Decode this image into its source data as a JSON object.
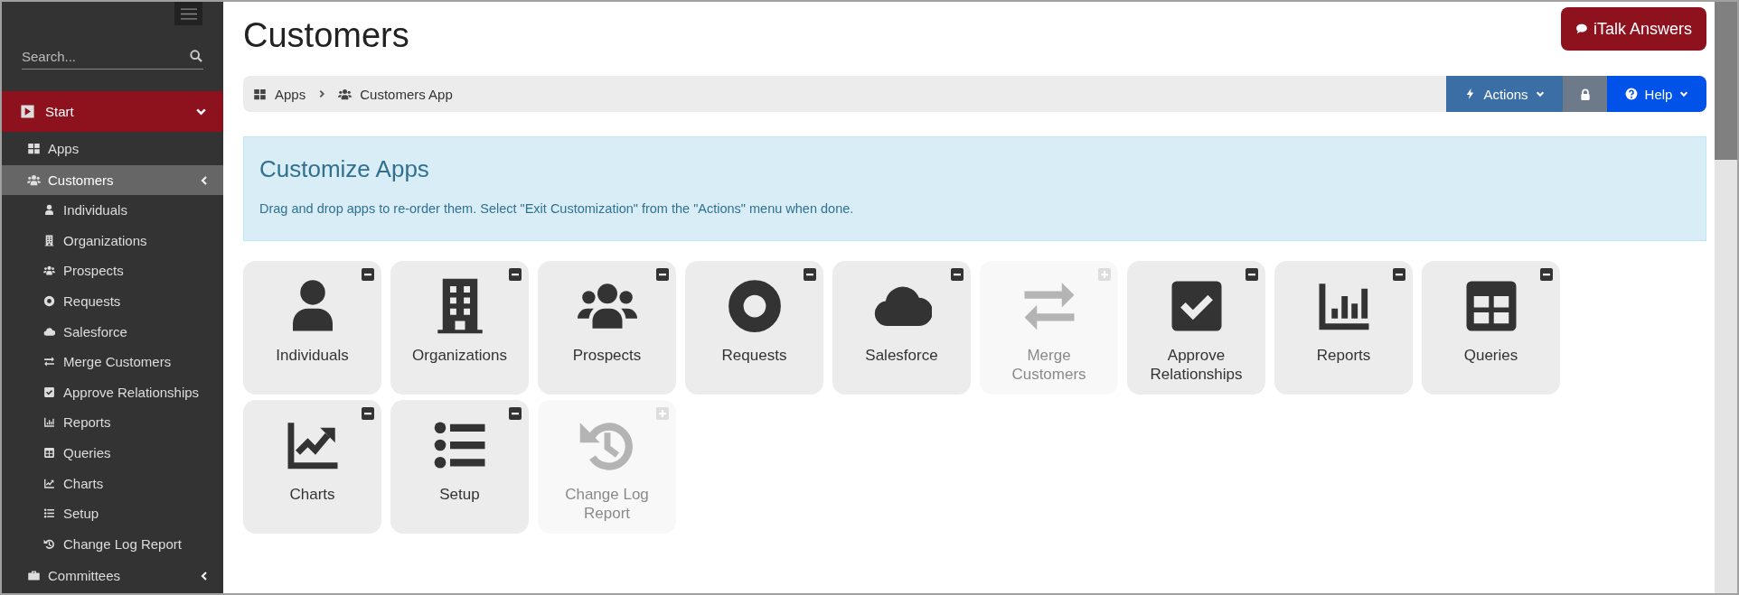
{
  "sidebar": {
    "search": {
      "placeholder": "Search..."
    },
    "start": {
      "label": "Start",
      "expanded": true
    },
    "items": [
      {
        "label": "Apps",
        "selected": false
      },
      {
        "label": "Customers",
        "selected": true,
        "children": [
          {
            "label": "Individuals"
          },
          {
            "label": "Organizations"
          },
          {
            "label": "Prospects"
          },
          {
            "label": "Requests"
          },
          {
            "label": "Salesforce"
          },
          {
            "label": "Merge Customers"
          },
          {
            "label": "Approve Relationships"
          },
          {
            "label": "Reports"
          },
          {
            "label": "Queries"
          },
          {
            "label": "Charts"
          },
          {
            "label": "Setup"
          },
          {
            "label": "Change Log Report"
          }
        ]
      },
      {
        "label": "Committees",
        "selected": false
      }
    ]
  },
  "page": {
    "title": "Customers",
    "italk_button": "iTalk Answers"
  },
  "breadcrumb": [
    "Apps",
    "Customers App"
  ],
  "toolbar": {
    "actions": "Actions",
    "help": "Help"
  },
  "alert": {
    "title": "Customize Apps",
    "text": "Drag and drop apps to re-order them. Select \"Exit Customization\" from the \"Actions\" menu when done."
  },
  "apps": [
    {
      "label": "Individuals",
      "enabled": true
    },
    {
      "label": "Organizations",
      "enabled": true
    },
    {
      "label": "Prospects",
      "enabled": true
    },
    {
      "label": "Requests",
      "enabled": true
    },
    {
      "label": "Salesforce",
      "enabled": true
    },
    {
      "label": "Merge Customers",
      "enabled": false
    },
    {
      "label": "Approve Relationships",
      "enabled": true
    },
    {
      "label": "Reports",
      "enabled": true
    },
    {
      "label": "Queries",
      "enabled": true
    },
    {
      "label": "Charts",
      "enabled": true
    },
    {
      "label": "Setup",
      "enabled": true
    },
    {
      "label": "Change Log Report",
      "enabled": false
    }
  ]
}
